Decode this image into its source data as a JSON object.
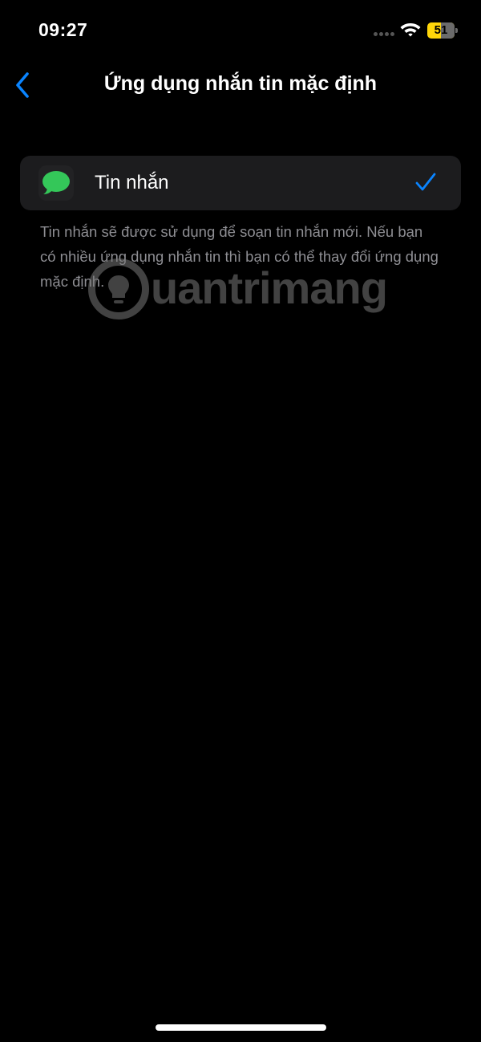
{
  "status_bar": {
    "time": "09:27",
    "battery_level": "51",
    "battery_fraction": 0.51,
    "colors": {
      "battery_fill": "#ffd60a",
      "battery_empty": "#6b6b6b"
    },
    "icons": [
      "signal-dots-icon",
      "wifi-icon",
      "battery-icon"
    ]
  },
  "nav": {
    "title": "Ứng dụng nhắn tin mặc định",
    "back_icon": "chevron-left-icon"
  },
  "options": [
    {
      "label": "Tin nhắn",
      "icon": "messages-app-icon",
      "selected": true
    }
  ],
  "description": "Tin nhắn sẽ được sử dụng để soạn tin nhắn mới. Nếu bạn có nhiều ứng dụng nhắn tin thì bạn có thể thay đổi ứng dụng mặc định.",
  "watermark": {
    "text": "uantrimang",
    "icon": "lightbulb-logo-icon"
  },
  "colors": {
    "background": "#000000",
    "card": "#1c1c1e",
    "accent": "#0a84ff",
    "secondary_text": "#8e8e93",
    "messages_green": "#34c759"
  }
}
